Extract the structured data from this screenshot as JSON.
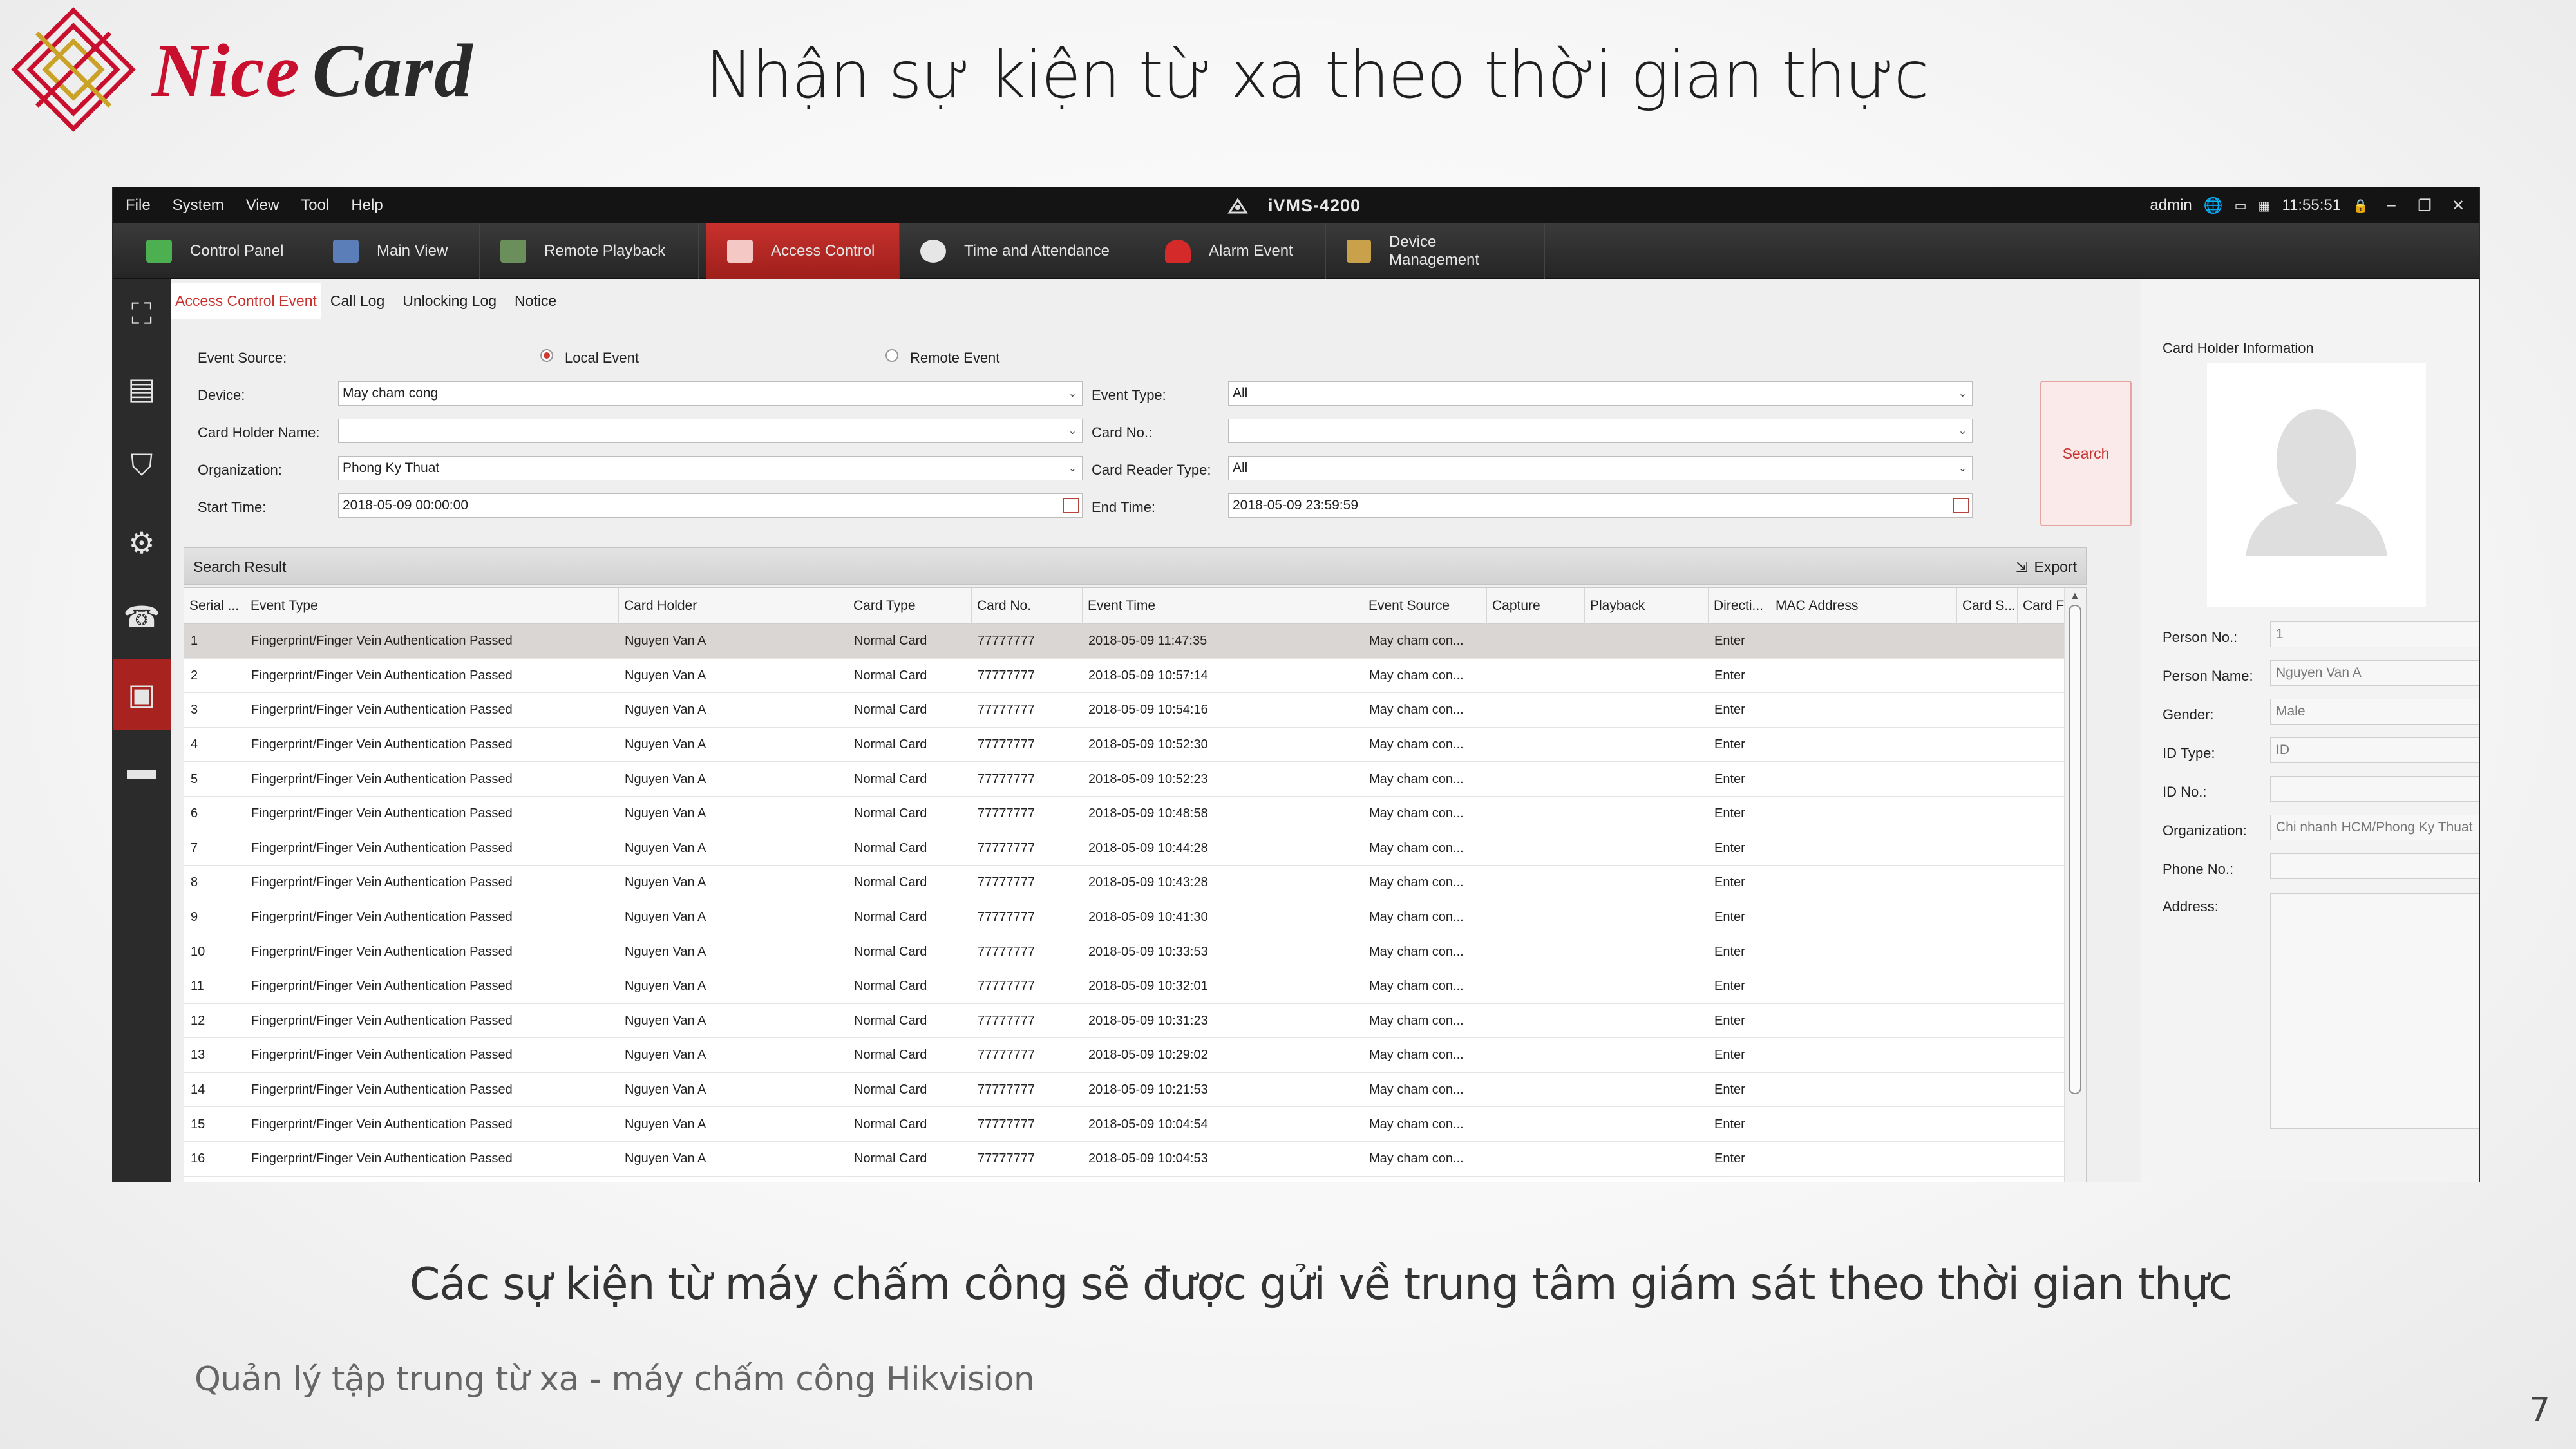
{
  "slide": {
    "logo": {
      "nice": "Nice",
      "card": "Card"
    },
    "title": "Nhận sự kiện từ xa theo thời gian thực",
    "caption": "Các sự kiện từ máy chấm công sẽ được gửi về trung tâm giám sát theo thời gian thực",
    "footer": "Quản lý tập trung từ xa - máy chấm công Hikvision",
    "page_number": "7"
  },
  "app": {
    "menu": [
      "File",
      "System",
      "View",
      "Tool",
      "Help"
    ],
    "title": "iVMS-4200",
    "user": "admin",
    "clock": "11:55:51",
    "main_tabs": [
      {
        "label": "Control Panel",
        "icon": "control-panel-icon",
        "color": "#4caf50"
      },
      {
        "label": "Main View",
        "icon": "main-view-icon",
        "color": "#5b7db8"
      },
      {
        "label": "Remote Playback",
        "icon": "remote-playback-icon",
        "color": "#6a8f5a"
      },
      {
        "label": "Access Control",
        "icon": "access-control-icon",
        "color": "#e04b3f"
      },
      {
        "label": "Time and Attendance",
        "icon": "time-attendance-icon",
        "color": "#e6e6e6"
      },
      {
        "label": "Alarm Event",
        "icon": "alarm-event-icon",
        "color": "#d42a2a"
      },
      {
        "label": "Device Management",
        "icon": "device-management-icon",
        "color": "#c9a14a"
      }
    ],
    "sub_tabs": [
      "Access Control Event",
      "Call Log",
      "Unlocking Log",
      "Notice"
    ],
    "form": {
      "event_source_label": "Event Source:",
      "local_event": "Local Event",
      "remote_event": "Remote Event",
      "device_label": "Device:",
      "device_value": "May cham cong",
      "card_holder_name_label": "Card Holder Name:",
      "card_holder_name_value": "",
      "organization_label": "Organization:",
      "organization_value": "Phong Ky Thuat",
      "start_time_label": "Start Time:",
      "start_time_value": "2018-05-09 00:00:00",
      "event_type_label": "Event Type:",
      "event_type_value": "All",
      "card_no_label": "Card No.:",
      "card_no_value": "",
      "card_reader_type_label": "Card Reader Type:",
      "card_reader_type_value": "All",
      "end_time_label": "End Time:",
      "end_time_value": "2018-05-09 23:59:59",
      "search_button": "Search"
    },
    "results": {
      "title": "Search Result",
      "export": "Export",
      "columns": [
        "Serial ...",
        "Event Type",
        "Card Holder",
        "Card Type",
        "Card No.",
        "Event Time",
        "Event Source",
        "Capture",
        "Playback",
        "Directi...",
        "MAC Address",
        "Card S...",
        "Card F"
      ],
      "rows": [
        [
          "1",
          "Fingerprint/Finger Vein Authentication Passed",
          "Nguyen Van A",
          "Normal Card",
          "77777777",
          "2018-05-09 11:47:35",
          "May cham con...",
          "Enter"
        ],
        [
          "2",
          "Fingerprint/Finger Vein Authentication Passed",
          "Nguyen Van A",
          "Normal Card",
          "77777777",
          "2018-05-09 10:57:14",
          "May cham con...",
          "Enter"
        ],
        [
          "3",
          "Fingerprint/Finger Vein Authentication Passed",
          "Nguyen Van A",
          "Normal Card",
          "77777777",
          "2018-05-09 10:54:16",
          "May cham con...",
          "Enter"
        ],
        [
          "4",
          "Fingerprint/Finger Vein Authentication Passed",
          "Nguyen Van A",
          "Normal Card",
          "77777777",
          "2018-05-09 10:52:30",
          "May cham con...",
          "Enter"
        ],
        [
          "5",
          "Fingerprint/Finger Vein Authentication Passed",
          "Nguyen Van A",
          "Normal Card",
          "77777777",
          "2018-05-09 10:52:23",
          "May cham con...",
          "Enter"
        ],
        [
          "6",
          "Fingerprint/Finger Vein Authentication Passed",
          "Nguyen Van A",
          "Normal Card",
          "77777777",
          "2018-05-09 10:48:58",
          "May cham con...",
          "Enter"
        ],
        [
          "7",
          "Fingerprint/Finger Vein Authentication Passed",
          "Nguyen Van A",
          "Normal Card",
          "77777777",
          "2018-05-09 10:44:28",
          "May cham con...",
          "Enter"
        ],
        [
          "8",
          "Fingerprint/Finger Vein Authentication Passed",
          "Nguyen Van A",
          "Normal Card",
          "77777777",
          "2018-05-09 10:43:28",
          "May cham con...",
          "Enter"
        ],
        [
          "9",
          "Fingerprint/Finger Vein Authentication Passed",
          "Nguyen Van A",
          "Normal Card",
          "77777777",
          "2018-05-09 10:41:30",
          "May cham con...",
          "Enter"
        ],
        [
          "10",
          "Fingerprint/Finger Vein Authentication Passed",
          "Nguyen Van A",
          "Normal Card",
          "77777777",
          "2018-05-09 10:33:53",
          "May cham con...",
          "Enter"
        ],
        [
          "11",
          "Fingerprint/Finger Vein Authentication Passed",
          "Nguyen Van A",
          "Normal Card",
          "77777777",
          "2018-05-09 10:32:01",
          "May cham con...",
          "Enter"
        ],
        [
          "12",
          "Fingerprint/Finger Vein Authentication Passed",
          "Nguyen Van A",
          "Normal Card",
          "77777777",
          "2018-05-09 10:31:23",
          "May cham con...",
          "Enter"
        ],
        [
          "13",
          "Fingerprint/Finger Vein Authentication Passed",
          "Nguyen Van A",
          "Normal Card",
          "77777777",
          "2018-05-09 10:29:02",
          "May cham con...",
          "Enter"
        ],
        [
          "14",
          "Fingerprint/Finger Vein Authentication Passed",
          "Nguyen Van A",
          "Normal Card",
          "77777777",
          "2018-05-09 10:21:53",
          "May cham con...",
          "Enter"
        ],
        [
          "15",
          "Fingerprint/Finger Vein Authentication Passed",
          "Nguyen Van A",
          "Normal Card",
          "77777777",
          "2018-05-09 10:04:54",
          "May cham con...",
          "Enter"
        ],
        [
          "16",
          "Fingerprint/Finger Vein Authentication Passed",
          "Nguyen Van A",
          "Normal Card",
          "77777777",
          "2018-05-09 10:04:53",
          "May cham con...",
          "Enter"
        ]
      ]
    },
    "holder_info": {
      "title": "Card Holder Information",
      "person_no_label": "Person No.:",
      "person_no": "1",
      "person_name_label": "Person Name:",
      "person_name": "Nguyen Van A",
      "gender_label": "Gender:",
      "gender": "Male",
      "id_type_label": "ID Type:",
      "id_type": "ID",
      "id_no_label": "ID No.:",
      "id_no": "",
      "organization_label": "Organization:",
      "organization": "Chi nhanh HCM/Phong Ky Thuat",
      "phone_label": "Phone No.:",
      "phone": "",
      "address_label": "Address:",
      "address": ""
    }
  }
}
